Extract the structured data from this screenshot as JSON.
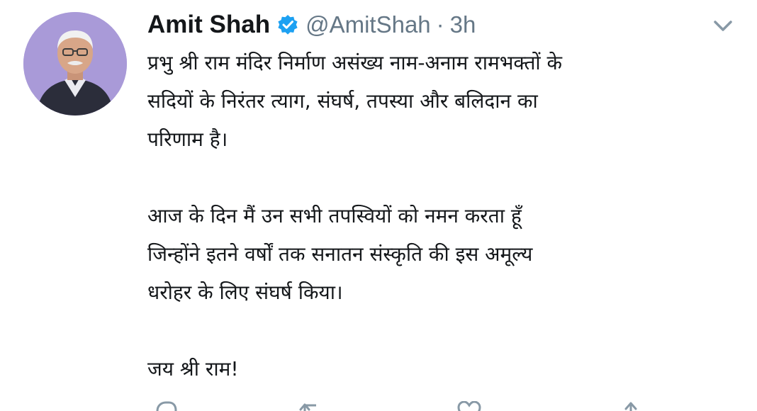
{
  "tweet": {
    "author": {
      "display_name": "Amit Shah",
      "handle": "@AmitShah",
      "separator": "·",
      "time": "3h",
      "verified": true,
      "avatar_icon": "profile-photo"
    },
    "menu_icon": "chevron-down-icon",
    "paragraphs": [
      "प्रभु श्री राम मंदिर निर्माण असंख्य नाम-अनाम रामभक्तों के\nसदियों के निरंतर त्याग, संघर्ष, तपस्या और बलिदान का\nपरिणाम है।",
      "आज के दिन मैं उन सभी तपस्वियों को नमन करता हूँ\nजिन्होंने इतने वर्षों तक सनातन संस्कृति की इस अमूल्य\nधरोहर के लिए संघर्ष किया।",
      "जय श्री राम!"
    ],
    "actions": [
      {
        "name": "reply-icon"
      },
      {
        "name": "retweet-icon"
      },
      {
        "name": "like-icon"
      },
      {
        "name": "share-icon"
      }
    ]
  },
  "colors": {
    "text_primary": "#14171a",
    "text_secondary": "#657786",
    "verified_blue": "#1da1f2",
    "background": "#ffffff"
  }
}
